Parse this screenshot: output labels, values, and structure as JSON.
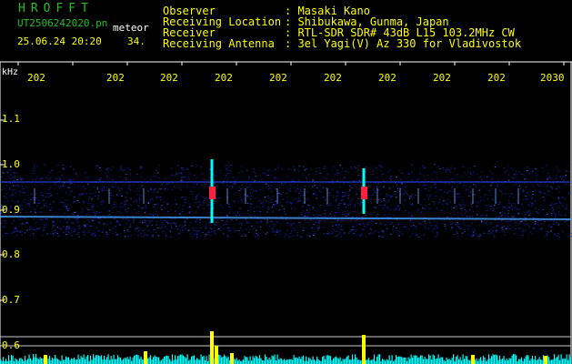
{
  "header": {
    "logo": "HROFFT",
    "filename": "UT2506242020.pn",
    "type_label": "meteor",
    "datetime": "25.06.24 20:20",
    "count": "34.",
    "fields": [
      {
        "label": "Observer",
        "value": ": Masaki Kano"
      },
      {
        "label": "Receiving Location",
        "value": ": Shibukawa, Gunma, Japan"
      },
      {
        "label": "Receiver",
        "value": ": RTL-SDR SDR# 43dB L15 103.2MHz CW"
      },
      {
        "label": "Receiving Antenna",
        "value": ": 3el Yagi(V) Az 330 for Vladivostok"
      }
    ]
  },
  "axis": {
    "y_unit": "kHz",
    "x_ticks": [
      "202",
      "202",
      "202",
      "202",
      "202",
      "202",
      "202",
      "202",
      "202",
      "2030"
    ],
    "y_ticks": [
      "1.1",
      "1.0",
      "0.9",
      "0.8",
      "0.7",
      "0.6"
    ]
  },
  "colors": {
    "header_green": "#22c022",
    "tick_yellow": "#ffff00",
    "signal_cyan": "#00ffff",
    "noise_blue": "#1a2bd0",
    "meteor_red": "#ff2040"
  }
}
